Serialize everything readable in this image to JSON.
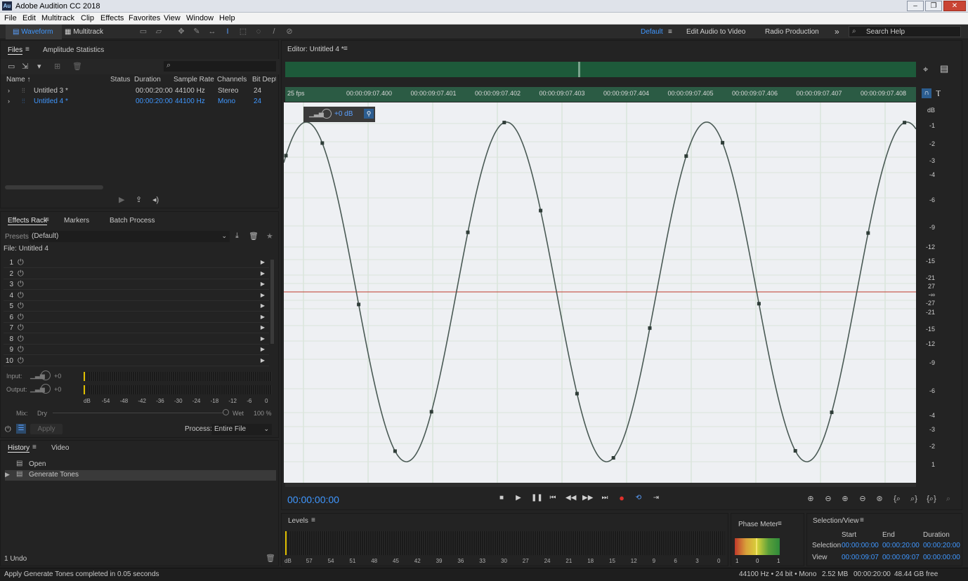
{
  "app": {
    "title": "Adobe Audition CC 2018",
    "icon_text": "Au"
  },
  "menu": [
    "File",
    "Edit",
    "Multitrack",
    "Clip",
    "Effects",
    "Favorites",
    "View",
    "Window",
    "Help"
  ],
  "toolbar": {
    "waveform_label": "Waveform",
    "multitrack_label": "Multitrack",
    "workspaces": [
      "Default",
      "Edit Audio to Video",
      "Radio Production"
    ],
    "more": "»",
    "search_placeholder": "Search Help"
  },
  "files_panel": {
    "tabs": [
      "Files",
      "Amplitude Statistics"
    ],
    "columns": [
      "Name ↑",
      "Status",
      "Duration",
      "Sample Rate",
      "Channels",
      "Bit Depth"
    ],
    "rows": [
      {
        "name": "Untitled 3 *",
        "status": "",
        "duration": "00:00:20:00",
        "rate": "44100 Hz",
        "channels": "Stereo",
        "bits": "24"
      },
      {
        "name": "Untitled 4 *",
        "status": "",
        "duration": "00:00:20:00",
        "rate": "44100 Hz",
        "channels": "Mono",
        "bits": "24"
      }
    ]
  },
  "effects_rack": {
    "tabs": [
      "Effects Rack",
      "Markers",
      "Batch Process"
    ],
    "presets_label": "Presets:",
    "presets_value": "(Default)",
    "file_label": "File: Untitled 4",
    "slots": [
      "1",
      "2",
      "3",
      "4",
      "5",
      "6",
      "7",
      "8",
      "9",
      "10"
    ],
    "input_label": "Input:",
    "output_label": "Output:",
    "input_value": "+0",
    "output_value": "+0",
    "meter_ticks": [
      "dB",
      "-54",
      "-48",
      "-42",
      "-36",
      "-30",
      "-24",
      "-18",
      "-12",
      "-6",
      "0"
    ],
    "mix_label": "Mix:",
    "dry_label": "Dry",
    "wet_label": "Wet",
    "wet_value": "100 %",
    "apply_label": "Apply",
    "process_label": "Process:",
    "process_value": "Entire File"
  },
  "history": {
    "tabs": [
      "History",
      "Video"
    ],
    "items": [
      "Open",
      "Generate Tones"
    ],
    "undo": "1 Undo"
  },
  "editor": {
    "tab_label": "Editor: Untitled 4 *",
    "fps": "25 fps",
    "ruler": [
      "00:00:09:07.400",
      "00:00:09:07.401",
      "00:00:09:07.402",
      "00:00:09:07.403",
      "00:00:09:07.404",
      "00:00:09:07.405",
      "00:00:09:07.406",
      "00:00:09:07.407",
      "00:00:09:07.408"
    ],
    "hud_gain": "+0 dB",
    "db_scale": [
      "dB",
      "-1",
      "-2",
      "-3",
      "-4",
      "-6",
      "-9",
      "-12",
      "-15",
      "-21",
      "27",
      "-∞",
      "-27",
      "-21",
      "-15",
      "-12",
      "-9",
      "-6",
      "-4",
      "-3",
      "-2",
      "1"
    ],
    "time": "00:00:00:00"
  },
  "levels": {
    "title": "Levels",
    "ticks": [
      "dB",
      "57",
      "54",
      "51",
      "48",
      "45",
      "42",
      "39",
      "36",
      "33",
      "30",
      "27",
      "24",
      "21",
      "18",
      "15",
      "12",
      "9",
      "6",
      "3",
      "0"
    ]
  },
  "phase_meter": {
    "title": "Phase Meter",
    "ticks": [
      "1",
      "0",
      "1"
    ]
  },
  "selection_view": {
    "title": "Selection/View",
    "headers": [
      "Start",
      "End",
      "Duration"
    ],
    "rows": [
      {
        "label": "Selection",
        "start": "00:00:00:00",
        "end": "00:00:20:00",
        "duration": "00:00:20:00"
      },
      {
        "label": "View",
        "start": "00:00:09:07",
        "end": "00:00:09:07",
        "duration": "00:00:00:00"
      }
    ]
  },
  "status": {
    "message": "Apply Generate Tones completed in 0.05 seconds",
    "format": "44100 Hz • 24 bit • Mono",
    "size": "2.52 MB",
    "duration": "00:00:20:00",
    "free": "48.44 GB free"
  },
  "colors": {
    "accent": "#3f97ff",
    "wave": "#4a5a55",
    "center_line": "#c0392b",
    "overview": "#1d5a3a",
    "record": "#e0302b"
  }
}
